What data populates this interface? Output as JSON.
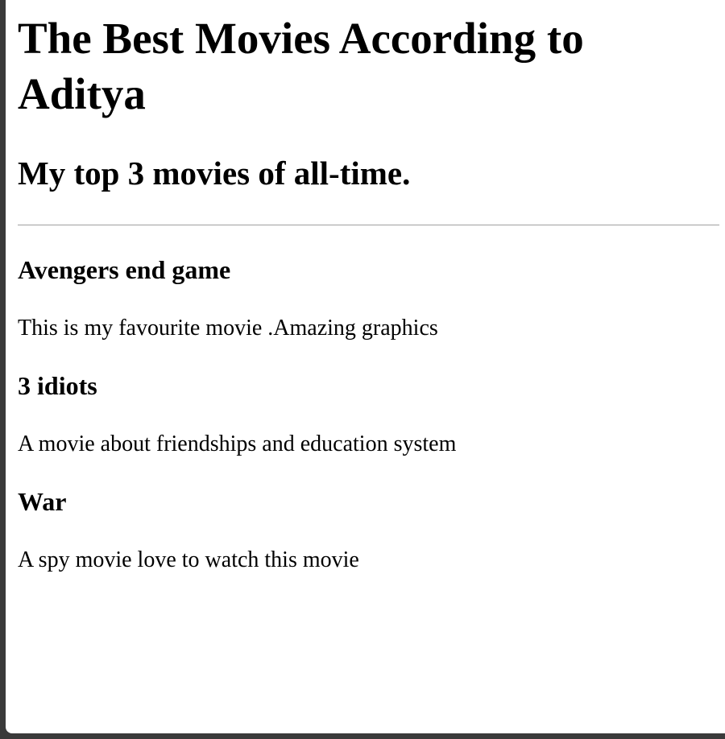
{
  "page": {
    "title": "The Best Movies According to Aditya",
    "subtitle": "My top 3 movies of all-time."
  },
  "movies": [
    {
      "title": "Avengers end game",
      "description": "This is my favourite movie .Amazing graphics"
    },
    {
      "title": "3 idiots",
      "description": "A movie about friendships and education system"
    },
    {
      "title": "War",
      "description": "A spy movie love to watch this movie"
    }
  ]
}
